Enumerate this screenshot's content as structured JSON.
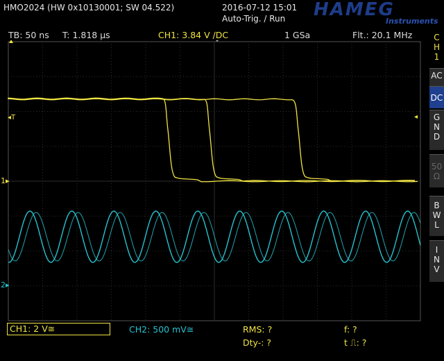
{
  "header": {
    "device": "HMO2024 (HW 0x10130001; SW 04.522)",
    "datetime": "2016-07-12 15:01",
    "trigger_mode": "Auto-Trig. / Run",
    "logo": "HAMEG",
    "logo_sub": "Instruments"
  },
  "info_bar": {
    "timebase": "TB: 50 ns",
    "trigger_time": "T: 1.818 µs",
    "trigger_level": "CH1: 3.84 V ∕DC",
    "sample_rate": "1 GSa",
    "filter": "Flt.: 20.1 MHz"
  },
  "side_panel": {
    "channel_label": [
      "C",
      "H",
      "1"
    ],
    "buttons": [
      {
        "label": [
          "A",
          "C"
        ],
        "active": false
      },
      {
        "label": [
          "D",
          "C"
        ],
        "active": true
      },
      {
        "label": [
          "G",
          "N",
          "D"
        ],
        "active": false
      },
      {
        "label": [
          "50",
          "Ω"
        ],
        "active": false,
        "disabled": true
      },
      {
        "label": [
          "B",
          "W",
          "L"
        ],
        "active": false
      },
      {
        "label": [
          "I",
          "N",
          "V"
        ],
        "active": false
      }
    ]
  },
  "markers": {
    "trigger_T": "T",
    "ch1": "1",
    "ch2": "2"
  },
  "bottom_bar": {
    "ch1": "CH1: 2 V≅",
    "ch2": "CH2: 500 mV≅",
    "rms": "RMS: ?",
    "dty": "Dty-: ?",
    "freq": "f: ?",
    "pulse": "t ⎍: ?"
  },
  "colors": {
    "ch1": "#f0e442",
    "ch2": "#27c3d0",
    "grid": "#2e2e2e",
    "accent": "#1f3f8f"
  }
}
